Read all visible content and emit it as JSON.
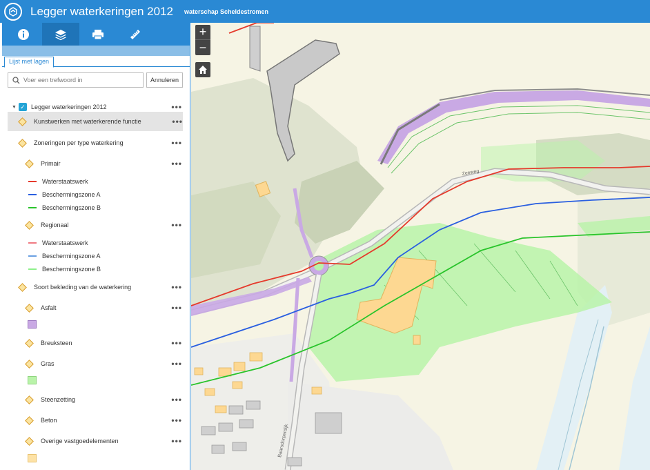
{
  "header": {
    "title": "Legger waterkeringen 2012",
    "subtitle": "waterschap Scheldestromen",
    "color": "#2a89d4"
  },
  "toolbar": {
    "tools": [
      "info-icon",
      "layers-icon",
      "print-icon",
      "measure-icon"
    ]
  },
  "tab": {
    "label": "Lijst met lagen"
  },
  "search": {
    "placeholder": "Voer een trefwoord in",
    "value": "",
    "cancel_label": "Annuleren"
  },
  "layers": {
    "root": "Legger waterkeringen 2012",
    "kunstwerken": "Kunstwerken met waterkerende functie",
    "zoneringen": "Zoneringen per type waterkering",
    "primair": "Primair",
    "primair_items": [
      "Waterstaatswerk",
      "Beschermingszone A",
      "Beschermingszone B"
    ],
    "regionaal": "Regionaal",
    "regionaal_items": [
      "Waterstaatswerk",
      "Beschermingszone A",
      "Beschermingszone B"
    ],
    "bekleding": "Soort bekleding van de waterkering",
    "asfalt": "Asfalt",
    "breuksteen": "Breuksteen",
    "gras": "Gras",
    "steenzetting": "Steenzetting",
    "beton": "Beton",
    "overige": "Overige vastgoedelementen",
    "more": "•••"
  },
  "colors": {
    "primair": [
      "#e53a2c",
      "#2a5fe0",
      "#29c42b"
    ],
    "regionaal": [
      "#f07a82",
      "#6aa0e2",
      "#8ef08b"
    ],
    "asfalt": "#c9a9e4",
    "gras": "#b9f3a9",
    "overige": "#fde2a6"
  },
  "map": {
    "zoom_in": "+",
    "zoom_out": "−",
    "road_label_1": "Zeeweg",
    "road_label_2": "Baarsdorperdijk"
  }
}
